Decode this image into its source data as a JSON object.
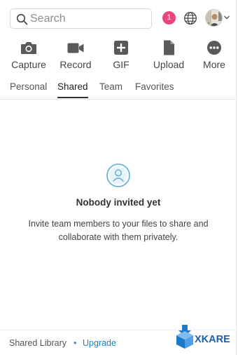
{
  "search": {
    "placeholder": "Search",
    "value": ""
  },
  "notifications": {
    "count": "1",
    "color": "#e8467c"
  },
  "toolbar": {
    "items": [
      {
        "label": "Capture",
        "icon": "camera-icon"
      },
      {
        "label": "Record",
        "icon": "video-icon"
      },
      {
        "label": "GIF",
        "icon": "gif-icon"
      },
      {
        "label": "Upload",
        "icon": "file-icon"
      },
      {
        "label": "More",
        "icon": "more-icon"
      }
    ]
  },
  "tabs": [
    {
      "label": "Personal",
      "active": false
    },
    {
      "label": "Shared",
      "active": true
    },
    {
      "label": "Team",
      "active": false
    },
    {
      "label": "Favorites",
      "active": false
    }
  ],
  "empty_state": {
    "title": "Nobody invited yet",
    "description": "Invite team members to your files to share and collaborate with them privately."
  },
  "footer": {
    "library_label": "Shared Library",
    "separator": "•",
    "upgrade_label": "Upgrade"
  },
  "watermark": {
    "text": "XKARE"
  },
  "colors": {
    "accent": "#1a7fb8",
    "illustration": "#5aaed6"
  }
}
